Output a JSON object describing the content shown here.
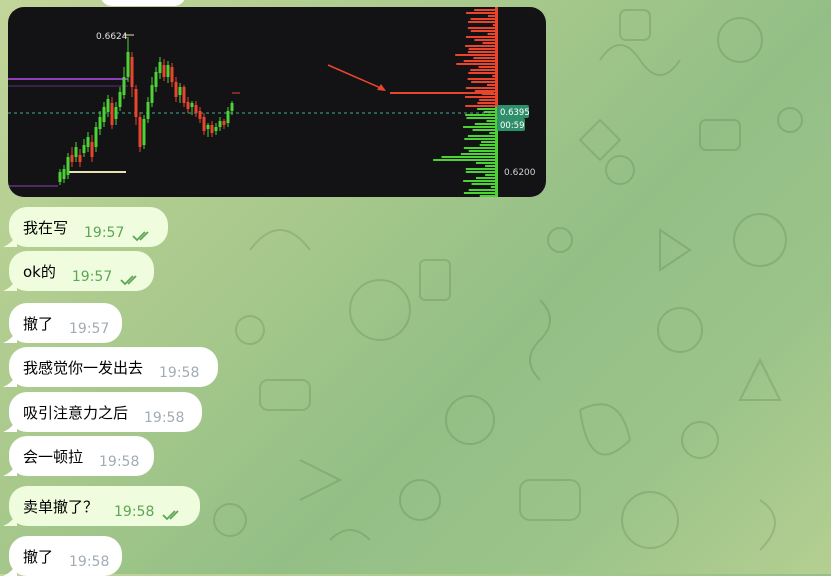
{
  "chart_image": {
    "price_high_label": "0.6624",
    "current_price_label": "0.6395",
    "countdown_label": "00:59",
    "price_low_label": "0.6200"
  },
  "messages": [
    {
      "text": "我在写",
      "time": "19:57",
      "type": "outgoing",
      "read": true
    },
    {
      "text": "ok的",
      "time": "19:57",
      "type": "outgoing",
      "read": true
    },
    {
      "text": "撤了",
      "time": "19:57",
      "type": "incoming",
      "read": false
    },
    {
      "text": "我感觉你一发出去",
      "time": "19:58",
      "type": "incoming",
      "read": false
    },
    {
      "text": "吸引注意力之后",
      "time": "19:58",
      "type": "incoming",
      "read": false
    },
    {
      "text": "会一顿拉",
      "time": "19:58",
      "type": "incoming",
      "read": false
    },
    {
      "text": "卖单撤了？",
      "time": "19:58",
      "type": "outgoing",
      "read": true
    },
    {
      "text": "撤了",
      "time": "19:58",
      "type": "incoming",
      "read": false
    }
  ],
  "colors": {
    "outgoing_bubble": "#effdde",
    "incoming_bubble": "#ffffff",
    "outgoing_time": "#5da655",
    "incoming_time": "#a2acb4",
    "candle_up": "#4cd137",
    "candle_down": "#e8452c"
  }
}
